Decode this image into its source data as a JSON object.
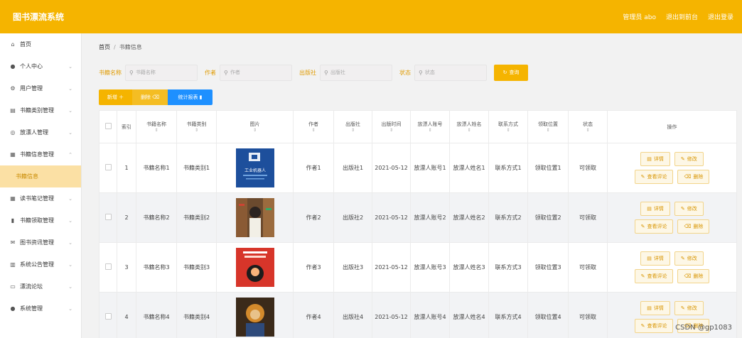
{
  "app": {
    "title": "图书漂流系统",
    "admin": "管理员 abo",
    "back_front": "退出到前台",
    "logout": "退出登录"
  },
  "sidebar": {
    "items": [
      {
        "label": "首页",
        "icon": "home-icon",
        "glyph": "⌂",
        "arrow": false
      },
      {
        "label": "个人中心",
        "icon": "user-icon",
        "glyph": "●",
        "arrow": true
      },
      {
        "label": "用户管理",
        "icon": "users-icon",
        "glyph": "⚙",
        "arrow": true
      },
      {
        "label": "书籍类别管理",
        "icon": "category-icon",
        "glyph": "▤",
        "arrow": true
      },
      {
        "label": "放漂人管理",
        "icon": "person-icon",
        "glyph": "◎",
        "arrow": true
      },
      {
        "label": "书籍信息管理",
        "icon": "book-icon",
        "glyph": "▦",
        "arrow": true,
        "expanded": true
      },
      {
        "label": "书籍信息",
        "sub": true,
        "active": true
      },
      {
        "label": "读书笔记管理",
        "icon": "grid-icon",
        "glyph": "▦",
        "arrow": true
      },
      {
        "label": "书籍领取管理",
        "icon": "bar-icon",
        "glyph": "▮",
        "arrow": true
      },
      {
        "label": "图书资讯管理",
        "icon": "mail-icon",
        "glyph": "✉",
        "arrow": true
      },
      {
        "label": "系统公告管理",
        "icon": "notice-icon",
        "glyph": "▥",
        "arrow": true
      },
      {
        "label": "漂流论坛",
        "icon": "forum-icon",
        "glyph": "▭",
        "arrow": true
      },
      {
        "label": "系统管理",
        "icon": "system-icon",
        "glyph": "●",
        "arrow": true
      }
    ]
  },
  "breadcrumb": {
    "home": "首页",
    "sep": "/",
    "current": "书籍信息"
  },
  "search": {
    "name_label": "书籍名称",
    "name_placeholder": "书籍名称",
    "author_label": "作者",
    "author_placeholder": "作者",
    "publisher_label": "出版社",
    "publisher_placeholder": "出版社",
    "status_label": "状态",
    "status_placeholder": "状态",
    "query_label": "查询"
  },
  "actions": {
    "add": "新增 ＋",
    "delete": "删除 ⌫",
    "stats": "统计报表 ▮"
  },
  "table": {
    "headers": [
      "",
      "索引",
      "书籍名称",
      "书籍类别",
      "图片",
      "作者",
      "出版社",
      "出版时间",
      "放漂人账号",
      "放漂人姓名",
      "联系方式",
      "领取位置",
      "状态",
      "操作"
    ],
    "sort_glyph": "⇕",
    "op_labels": {
      "detail": "详情",
      "edit": "修改",
      "review": "查看评论",
      "delete": "删除"
    },
    "rows": [
      {
        "idx": "1",
        "name": "书籍名称1",
        "cat": "书籍类别1",
        "author": "作者1",
        "pub": "出版社1",
        "date": "2021-05-12",
        "acct": "放漂人账号1",
        "pname": "放漂人姓名1",
        "contact": "联系方式1",
        "loc": "领取位置1",
        "status": "可领取"
      },
      {
        "idx": "2",
        "name": "书籍名称2",
        "cat": "书籍类别2",
        "author": "作者2",
        "pub": "出版社2",
        "date": "2021-05-12",
        "acct": "放漂人账号2",
        "pname": "放漂人姓名2",
        "contact": "联系方式2",
        "loc": "领取位置2",
        "status": "可领取"
      },
      {
        "idx": "3",
        "name": "书籍名称3",
        "cat": "书籍类别3",
        "author": "作者3",
        "pub": "出版社3",
        "date": "2021-05-12",
        "acct": "放漂人账号3",
        "pname": "放漂人姓名3",
        "contact": "联系方式3",
        "loc": "领取位置3",
        "status": "可领取"
      },
      {
        "idx": "4",
        "name": "书籍名称4",
        "cat": "书籍类别4",
        "author": "作者4",
        "pub": "出版社4",
        "date": "2021-05-12",
        "acct": "放漂人账号4",
        "pname": "放漂人姓名4",
        "contact": "联系方式4",
        "loc": "领取位置4",
        "status": "可领取"
      }
    ]
  },
  "book1_cover": {
    "line1": "工业机器人"
  },
  "watermark": "CSDN @gp1083",
  "colors": {
    "accent": "#f5b400",
    "stat": "#1e90ff"
  }
}
